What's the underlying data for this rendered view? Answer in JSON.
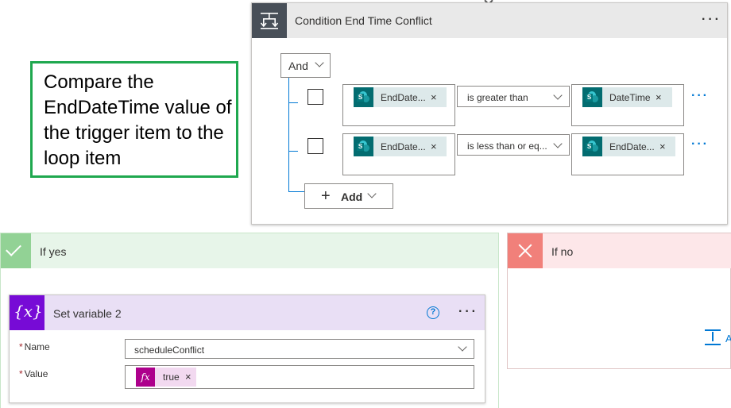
{
  "condition": {
    "title": "Condition End Time Conflict",
    "more": "···",
    "group_operator": "And",
    "rows": [
      {
        "left_token": "EndDate...",
        "operator": "is greater than",
        "right_token": "DateTime",
        "more": "···"
      },
      {
        "left_token": "EndDate...",
        "operator": "is less than or eq...",
        "right_token": "EndDate...",
        "more": "···"
      }
    ],
    "add_label": "Add",
    "remove_glyph": "×"
  },
  "annotation": {
    "text": "Compare the EndDateTime value of the trigger item to the loop item",
    "color": "#1fa84f"
  },
  "if_yes": {
    "title": "If yes"
  },
  "if_no": {
    "title": "If no",
    "insert_label": "A"
  },
  "set_variable": {
    "title": "Set variable 2",
    "icon_text": "{x}",
    "help": "?",
    "more": "···",
    "name_label": "Name",
    "name_value": "scheduleConflict",
    "value_label": "Value",
    "value_token": "true",
    "fx_icon": "fx",
    "required_mark": "*"
  },
  "icons": {
    "condition": "condition-icon",
    "sharepoint": "sharepoint-icon",
    "yes": "check-icon",
    "no": "close-icon",
    "variable": "variable-icon",
    "expression": "fx-icon"
  },
  "colors": {
    "accent": "#0078d4",
    "condition_header": "#484f58",
    "yes_accent": "#92d295",
    "no_accent": "#f1807a",
    "variable_accent": "#770bd6",
    "sharepoint": "#036c70"
  }
}
